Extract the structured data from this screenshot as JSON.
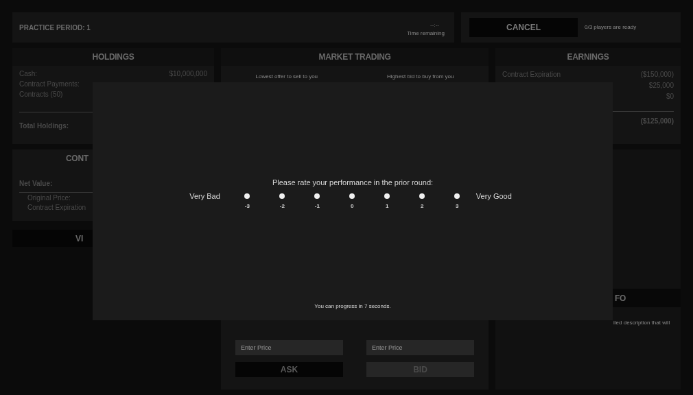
{
  "header": {
    "period": "PRACTICE PERIOD: 1",
    "timer": "--:--",
    "timer_label": "Time remaining",
    "cancel_button": "CANCEL",
    "ready_status": "0/3 players are ready"
  },
  "holdings": {
    "title": "HOLDINGS",
    "rows": [
      {
        "label": "Cash:",
        "value": "$10,000,000"
      },
      {
        "label": "Contract Payments:",
        "value": ""
      },
      {
        "label": "Contracts (50)",
        "value": ""
      }
    ],
    "total_label": "Total Holdings:"
  },
  "contract": {
    "title": "CONT",
    "net_label": "Net Value:",
    "rows": [
      "Original Price:",
      "Contract Expiration"
    ]
  },
  "left_button": "VI",
  "market": {
    "title": "MARKET TRADING",
    "offer_label": "Lowest offer to sell to you",
    "bid_label": "Highest bid to buy from you",
    "ask_placeholder": "Enter Price",
    "bid_placeholder": "Enter Price",
    "ask_button": "ASK",
    "bid_button": "BID"
  },
  "earnings": {
    "title": "EARNINGS",
    "rows": [
      {
        "label": "Contract Expiration",
        "value": "($150,000)"
      },
      {
        "label": "",
        "value": "$25,000"
      },
      {
        "label": "",
        "value": "$0"
      }
    ],
    "total": "($125,000)"
  },
  "info": {
    "title": "FO",
    "text": "iled description that will"
  },
  "modal": {
    "prompt": "Please rate your performance in the prior round:",
    "low_label": "Very Bad",
    "high_label": "Very Good",
    "options": [
      {
        "label": "-3",
        "selected": false
      },
      {
        "label": "-2",
        "selected": false
      },
      {
        "label": "-1",
        "selected": false
      },
      {
        "label": "0",
        "selected": false
      },
      {
        "label": "1",
        "selected": false
      },
      {
        "label": "2",
        "selected": false
      },
      {
        "label": "3",
        "selected": false
      }
    ],
    "footer": "You can progress in 7 seconds."
  }
}
